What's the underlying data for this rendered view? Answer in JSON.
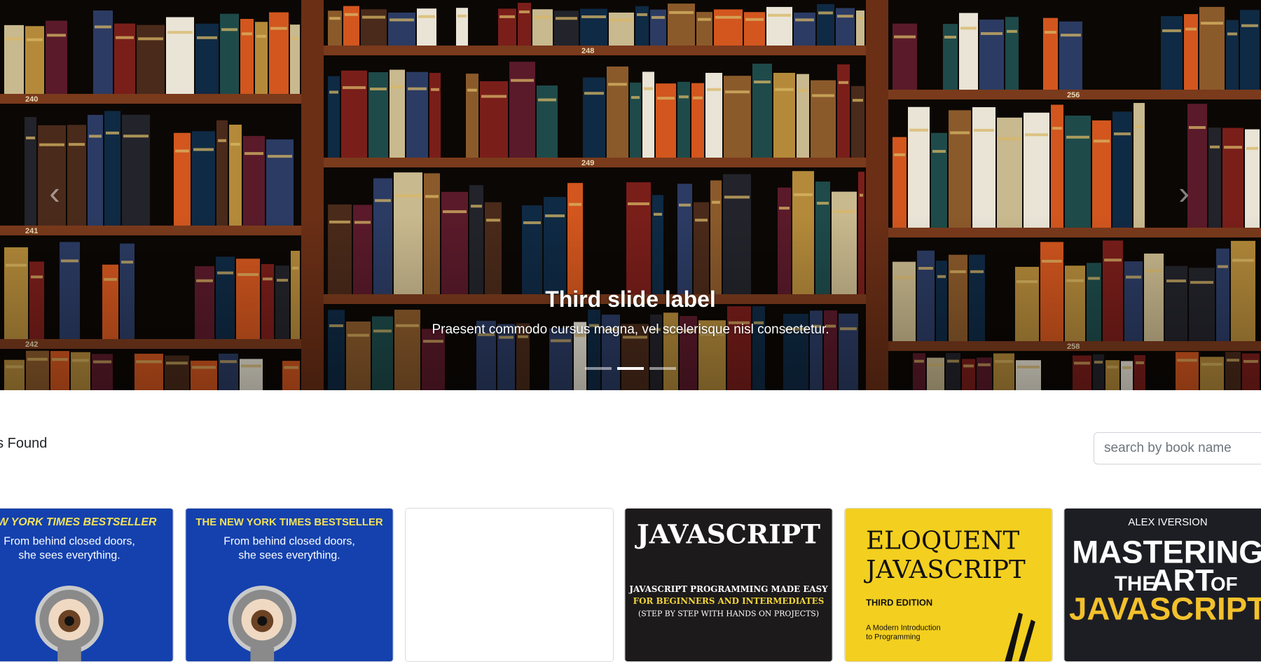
{
  "carousel": {
    "slide": {
      "title": "Third slide label",
      "text": "Praesent commodo cursus magna, vel scelerisque nisl consectetur."
    },
    "indicator_count": 3,
    "active_index": 1,
    "prev_icon": "chevron-left-icon",
    "next_icon": "chevron-right-icon",
    "shelf_labels": [
      "240",
      "248",
      "256",
      "249",
      "241",
      "242",
      "258"
    ]
  },
  "results": {
    "label": "oks Found"
  },
  "search": {
    "placeholder": "search by book name"
  },
  "books": [
    {
      "top": "NEW YORK TIMES BESTSELLER",
      "tag1": "From behind closed doors,",
      "tag2": "she sees everything."
    },
    {
      "top": "THE NEW YORK TIMES BESTSELLER",
      "tag1": "From behind closed doors,",
      "tag2": "she sees everything."
    },
    {},
    {
      "title": "JAVASCRIPT",
      "line1": "JAVASCRIPT PROGRAMMING MADE EASY",
      "line2": "FOR BEGINNERS AND INTERMEDIATES",
      "line3": "(STEP BY STEP WITH HANDS ON PROJECTS)"
    },
    {
      "title1": "ELOQUENT",
      "title2": "JAVASCRIPT",
      "edition": "THIRD EDITION",
      "sub1": "A Modern Introduction",
      "sub2": "to Programming"
    },
    {
      "author": "ALEX IVERSION",
      "t1": "MASTERING",
      "t2": "THE",
      "t3": "ART",
      "t4": "OF",
      "t5": "JAVASCRIPT"
    }
  ]
}
